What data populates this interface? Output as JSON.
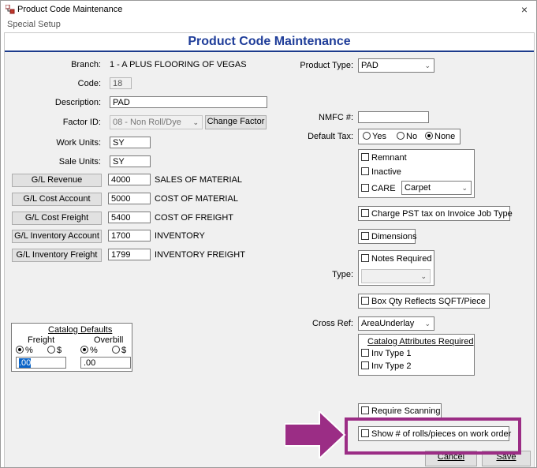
{
  "window": {
    "title": "Product Code Maintenance",
    "menu": "Special Setup",
    "close_glyph": "×",
    "heading": "Product Code Maintenance"
  },
  "left": {
    "branch_label": "Branch:",
    "branch_value": "1 - A PLUS FLOORING OF VEGAS",
    "code_label": "Code:",
    "code_value": "18",
    "description_label": "Description:",
    "description_value": "PAD",
    "factor_label": "Factor ID:",
    "factor_value": "08 - Non Roll/Dye",
    "change_factor": "Change Factor",
    "work_units_label": "Work Units:",
    "work_units_value": "SY",
    "sale_units_label": "Sale Units:",
    "sale_units_value": "SY",
    "gl_rows": [
      {
        "button": "G/L Revenue",
        "value": "4000",
        "desc": "SALES OF MATERIAL"
      },
      {
        "button": "G/L Cost Account",
        "value": "5000",
        "desc": "COST OF MATERIAL"
      },
      {
        "button": "G/L Cost Freight",
        "value": "5400",
        "desc": "COST OF FREIGHT"
      },
      {
        "button": "G/L Inventory Account",
        "value": "1700",
        "desc": "INVENTORY"
      },
      {
        "button": "G/L Inventory Freight",
        "value": "1799",
        "desc": "INVENTORY FREIGHT"
      }
    ],
    "catalog": {
      "title": "Catalog Defaults",
      "freight_label": "Freight",
      "overbill_label": "Overbill",
      "pct": "%",
      "dollar": "$",
      "freight_value": ".00",
      "overbill_value": ".00"
    }
  },
  "right": {
    "product_type_label": "Product Type:",
    "product_type_value": "PAD",
    "nmfc_label": "NMFC #:",
    "nmfc_value": "",
    "default_tax_label": "Default Tax:",
    "tax_yes": "Yes",
    "tax_no": "No",
    "tax_none": "None",
    "remnant": "Remnant",
    "inactive": "Inactive",
    "care": "CARE",
    "care_value": "Carpet",
    "charge_pst": "Charge PST tax on Invoice Job Type",
    "dimensions": "Dimensions",
    "notes_required": "Notes Required",
    "type_label": "Type:",
    "box_qty": "Box Qty Reflects SQFT/Piece",
    "cross_ref_label": "Cross Ref:",
    "cross_ref_value": "AreaUnderlay",
    "catalog_attr_title": "Catalog Attributes Required",
    "inv_type_1": "Inv Type 1",
    "inv_type_2": "Inv Type 2",
    "require_scanning": "Require Scanning",
    "show_rolls": "Show # of rolls/pieces on work order",
    "cancel": "Cancel",
    "save": "Save"
  },
  "colors": {
    "heading": "#1f3d99",
    "highlight": "#9b2d85"
  }
}
